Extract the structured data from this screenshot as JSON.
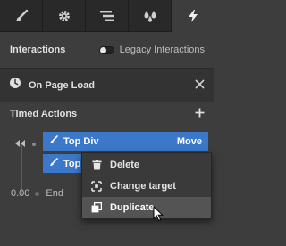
{
  "tabs": [
    {
      "icon": "brush-icon"
    },
    {
      "icon": "gear-icon"
    },
    {
      "icon": "layers-icon"
    },
    {
      "icon": "drops-icon"
    },
    {
      "icon": "lightning-icon"
    }
  ],
  "interactions": {
    "title": "Interactions",
    "toggle_label": "Legacy Interactions"
  },
  "trigger": {
    "label": "On Page Load"
  },
  "timed_actions": {
    "title": "Timed Actions"
  },
  "actions": [
    {
      "label": "Top Div",
      "type": "Move"
    },
    {
      "label": "Top"
    }
  ],
  "end": {
    "time": "0.00",
    "label": "End"
  },
  "context_menu": {
    "items": [
      {
        "label": "Delete",
        "icon": "trash-icon"
      },
      {
        "label": "Change target",
        "icon": "target-icon"
      },
      {
        "label": "Duplicate",
        "icon": "duplicate-icon"
      }
    ],
    "hover_index": 2
  },
  "colors": {
    "accent": "#3b78c9",
    "panel": "#3d3d3d",
    "tabbar": "#292929"
  }
}
